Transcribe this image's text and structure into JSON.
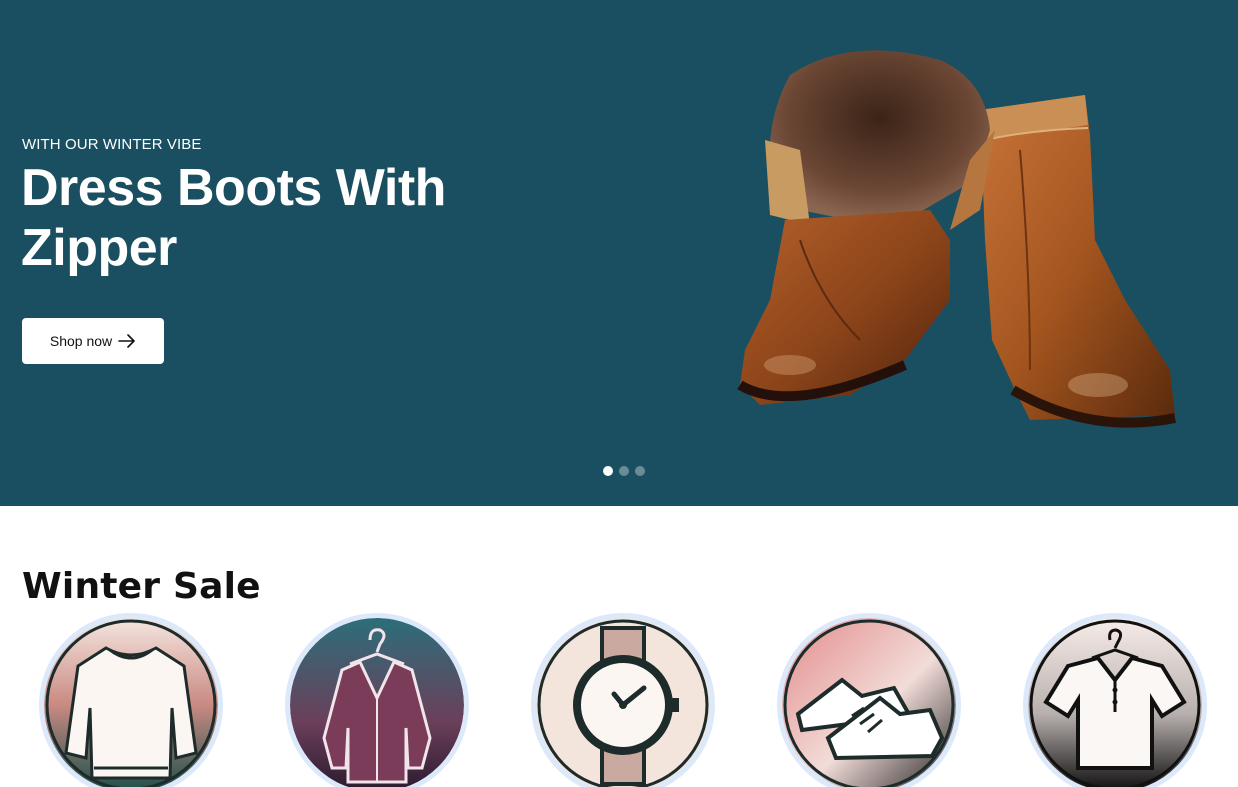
{
  "hero": {
    "eyebrow": "WITH OUR WINTER VIBE",
    "title": "Dress Boots With Zipper",
    "button_label": "Shop now",
    "background_color": "#194f60",
    "image_subject": "brown-leather-boots-with-fur-lining",
    "slide_count": 3,
    "active_slide": 1
  },
  "section": {
    "title": "Winter Sale"
  },
  "categories": [
    {
      "icon": "sweater-icon"
    },
    {
      "icon": "jacket-icon"
    },
    {
      "icon": "watch-icon"
    },
    {
      "icon": "sneakers-icon"
    },
    {
      "icon": "polo-shirt-icon"
    }
  ]
}
